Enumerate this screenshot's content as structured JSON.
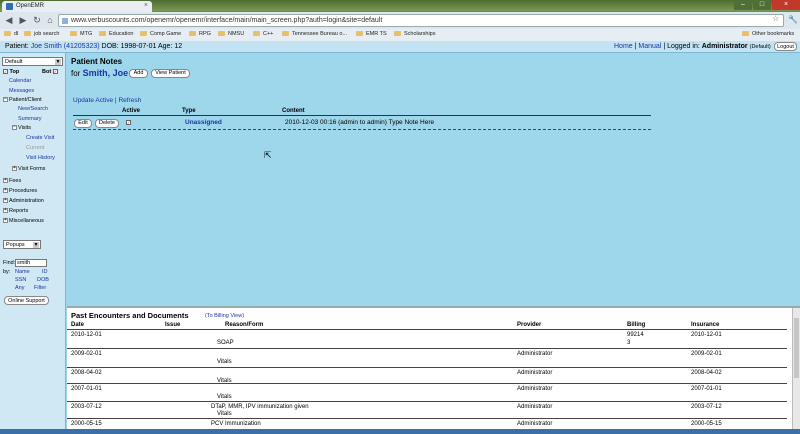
{
  "browser": {
    "tab_title": "OpenEMR",
    "url": "www.verbuscounts.com/openemr/openemr/interface/main/main_screen.php?auth=login&site=default",
    "bookmarks": [
      "dl",
      "job search",
      "MTG",
      "Education",
      "Comp Game",
      "RPG",
      "NMSU",
      "C++",
      "Tennessee Bureau o...",
      "EMR TS",
      "Scholarships"
    ],
    "other_bookmarks": "Other bookmarks"
  },
  "header": {
    "patient_label": "Patient:",
    "patient_name": "Joe Smith (41205323)",
    "patient_details": "DOB: 1998-07-01 Age: 12",
    "home": "Home",
    "manual": "Manual",
    "logged_in_label": "Logged in:",
    "user": "Administrator",
    "site": "(Default)",
    "logout": "Logout"
  },
  "sidebar": {
    "layout_select": "Default",
    "top_label": "Top",
    "bot_label": "Bot",
    "calendar": "Calendar",
    "messages": "Messages",
    "patient_client": "Patient/Client",
    "new_search": "New/Search",
    "summary": "Summary",
    "visits": "Visits",
    "create_visit": "Create Visit",
    "current": "Current",
    "visit_history": "Visit History",
    "visit_forms": "Visit Forms",
    "fees": "Fees",
    "procedures": "Procedures",
    "administration": "Administration",
    "reports": "Reports",
    "miscellaneous": "Miscellaneous",
    "popups_select": "Popups",
    "find_label": "Find:",
    "find_value": "smith",
    "by_label": "by:",
    "by_name": "Name",
    "by_id": "ID",
    "by_ssn": "SSN",
    "by_dob": "DOB",
    "by_any": "Any",
    "by_filter": "Filter",
    "online_support": "Online Support"
  },
  "notes": {
    "title": "Patient Notes",
    "for_label": "for",
    "patient_name": "Smith, Joe",
    "add_button": "Add",
    "view_patient_button": "View Patient",
    "update_active": "Update Active",
    "separator": "|",
    "refresh": "Refresh",
    "col_active": "Active",
    "col_type": "Type",
    "col_content": "Content",
    "row": {
      "edit": "Edit",
      "delete": "Delete",
      "active": "✓",
      "type": "Unassigned",
      "content": "2010-12-03 00:16 (admin to admin) Type Note Here"
    }
  },
  "encounters": {
    "title": "Past Encounters and Documents",
    "billing_view": "(To Billing View)",
    "columns": [
      "Date",
      "Issue",
      "Reason/Form",
      "Provider",
      "Billing",
      "Insurance"
    ],
    "rows": [
      {
        "date": "2010-12-01",
        "reason": "",
        "form": "SOAP",
        "provider": "",
        "billing": "99214",
        "billing2": "3",
        "insurance": "2010-12-01"
      },
      {
        "date": "2009-02-01",
        "reason": "",
        "form": "Vitals",
        "provider": "Administrator",
        "billing": "",
        "billing2": "",
        "insurance": "2009-02-01"
      },
      {
        "date": "2008-04-02",
        "reason": "",
        "form": "Vitals",
        "provider": "Administrator",
        "billing": "",
        "billing2": "",
        "insurance": "2008-04-02"
      },
      {
        "date": "2007-01-01",
        "reason": "",
        "form": "Vitals",
        "provider": "Administrator",
        "billing": "",
        "billing2": "",
        "insurance": "2007-01-01"
      },
      {
        "date": "2003-07-12",
        "reason": "DTaP, MMR, IPV immunization given",
        "form": "Vitals",
        "provider": "Administrator",
        "billing": "",
        "billing2": "",
        "insurance": "2003-07-12"
      },
      {
        "date": "2000-05-15",
        "reason": "PCV Immunization",
        "form": "",
        "provider": "Administrator",
        "billing": "",
        "billing2": "",
        "insurance": "2000-05-15"
      }
    ]
  }
}
